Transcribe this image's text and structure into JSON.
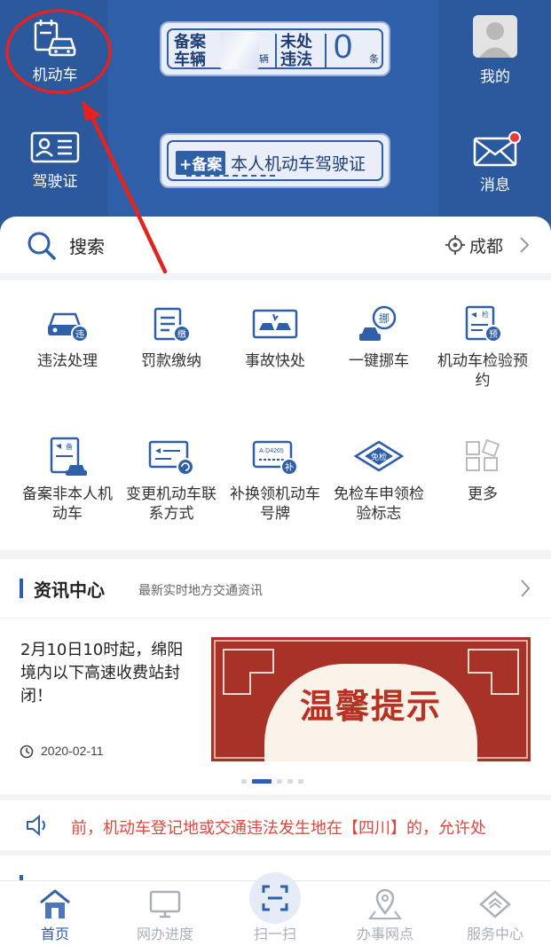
{
  "colors": {
    "primary": "#2f5fa8",
    "alert": "#e0463d",
    "muted": "#a9b0ba"
  },
  "header": {
    "vehicle_label": "机动车",
    "license_label": "驾驶证",
    "profile_label": "我的",
    "messages_label": "消息",
    "registered_vehicles": {
      "label": "备案车辆",
      "unit": "辆"
    },
    "violations": {
      "label": "未处违法",
      "count": "0",
      "unit": "条"
    },
    "register_license": {
      "badge": "+备案",
      "text": "本人机动车驾驶证"
    }
  },
  "search": {
    "label": "搜索",
    "city": "成都"
  },
  "services": [
    {
      "label": "违法处理",
      "icon": "car-violation-icon"
    },
    {
      "label": "罚款缴纳",
      "icon": "fine-payment-icon"
    },
    {
      "label": "事故快处",
      "icon": "accident-icon"
    },
    {
      "label": "一键挪车",
      "icon": "move-car-icon"
    },
    {
      "label": "机动车检验预约",
      "icon": "inspection-booking-icon"
    },
    {
      "label": "备案非本人机动车",
      "icon": "register-vehicle-icon"
    },
    {
      "label": "变更机动车联系方式",
      "icon": "change-contact-icon"
    },
    {
      "label": "补换领机动车号牌",
      "icon": "plate-replace-icon"
    },
    {
      "label": "免检车申领检验标志",
      "icon": "exempt-inspection-icon"
    },
    {
      "label": "更多",
      "icon": "more-icon"
    }
  ],
  "news": {
    "title": "资讯中心",
    "subtitle": "最新实时地方交通资讯",
    "headline": "2月10日10时起，绵阳境内以下高速收费站封闭！",
    "date": "2020-02-11",
    "banner_text": "温馨提示"
  },
  "marquee": "前，机动车登记地或交通违法发生地在【四川】的，允许处",
  "nav": {
    "home": "首页",
    "progress": "网办进度",
    "scan": "扫一扫",
    "outlets": "办事网点",
    "service": "服务中心"
  }
}
